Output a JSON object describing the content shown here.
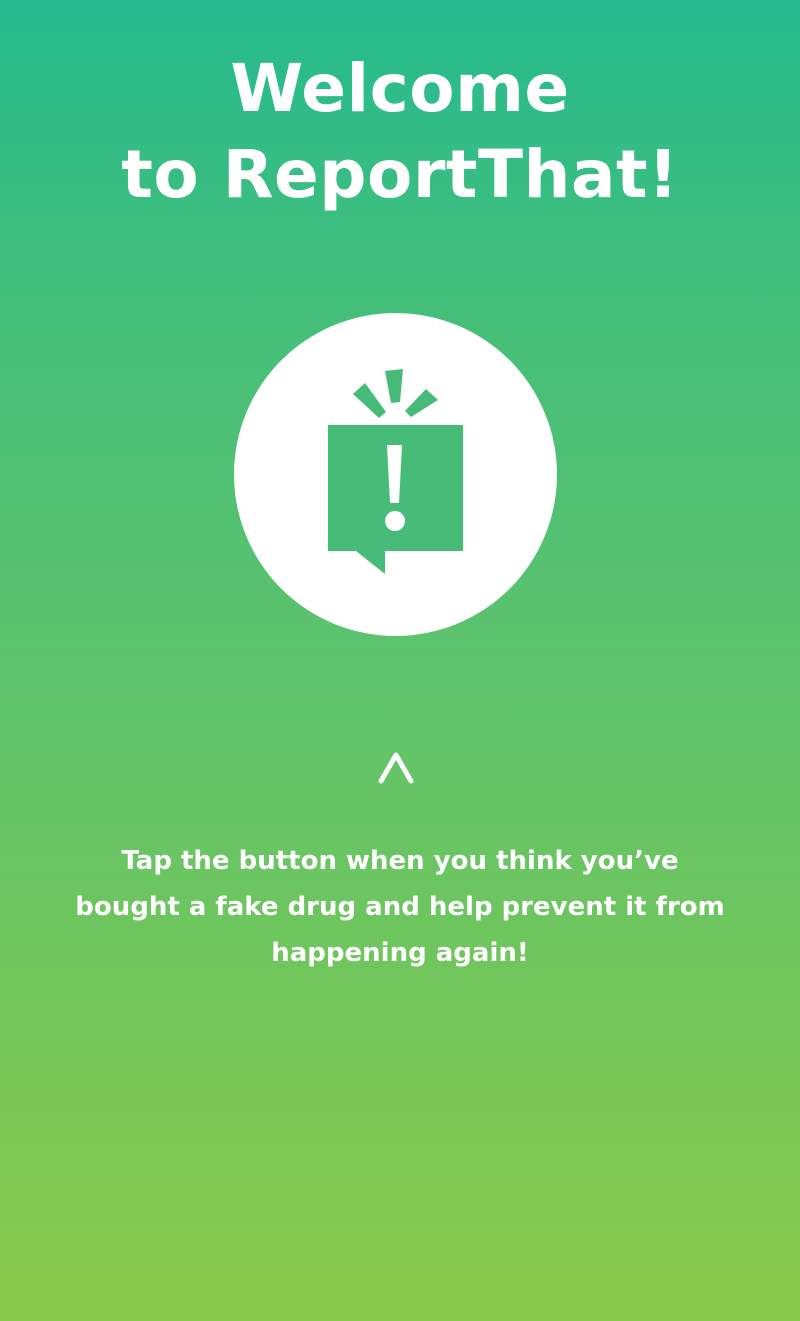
{
  "colors": {
    "gradient_top": "#25BB8E",
    "gradient_bottom": "#8AC94B",
    "icon_green": "#46BC78",
    "text": "#FFFFFF"
  },
  "welcome": {
    "title_line1": "Welcome",
    "title_line2": "to ReportThat!"
  },
  "report_button": {
    "icon": "report-exclamation-speech-bubble-icon"
  },
  "hint": {
    "arrow_icon": "chevron-up-icon",
    "line1": "Tap the button when you think you’ve",
    "line2": "bought a fake drug and help prevent it from",
    "line3": "happening again!"
  }
}
